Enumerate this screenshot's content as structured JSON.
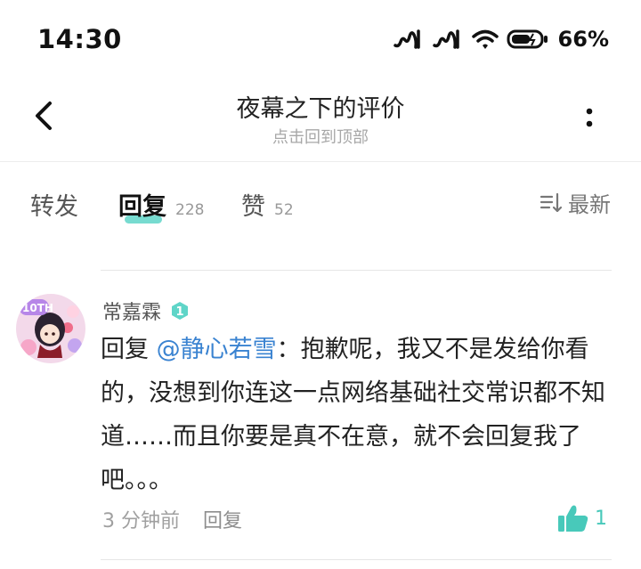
{
  "status_bar": {
    "time": "14:30",
    "battery_percent": "66%"
  },
  "header": {
    "title": "夜幕之下的评价",
    "subtitle": "点击回到顶部"
  },
  "tabs": [
    {
      "label": "转发",
      "count": ""
    },
    {
      "label": "回复",
      "count": "228"
    },
    {
      "label": "赞",
      "count": "52"
    }
  ],
  "sort": {
    "label": "最新"
  },
  "comment": {
    "username": "常嘉霖",
    "level": "1",
    "avatar_badge": "10TH",
    "reply_prefix": "回复 ",
    "mention": "@静心若雪",
    "text": "：抱歉呢，我又不是发给你看的，没想到你连这一点网络基础社交常识都不知道……而且你要是真不在意，就不会回复我了吧。。。",
    "time": "3 分钟前",
    "reply_label": "回复",
    "like_count": "1"
  },
  "colors": {
    "accent": "#5fd5c8",
    "mention": "#3a83d1",
    "like": "#48c9ba"
  }
}
